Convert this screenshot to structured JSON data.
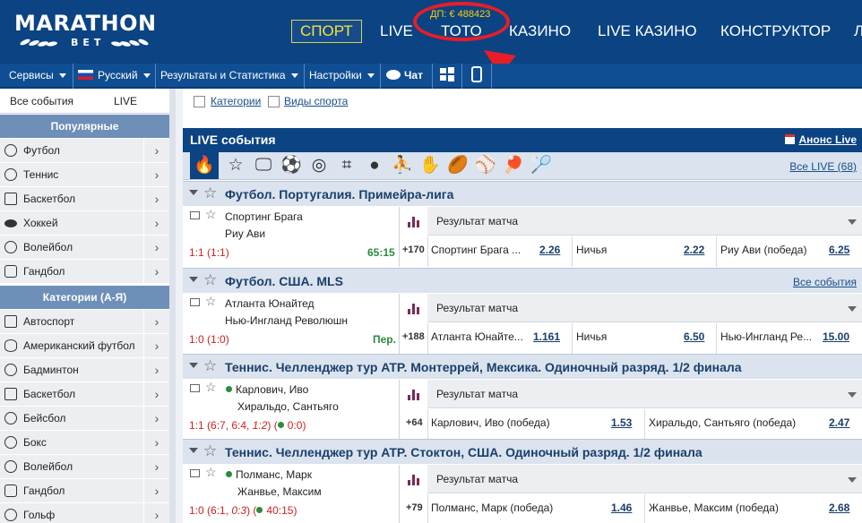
{
  "header": {
    "logo_top": "MARATHON",
    "logo_bottom": "BET",
    "nav": [
      "СПОРТ",
      "LIVE",
      "ТОТО",
      "КАЗИНО",
      "LIVE КАЗИНО",
      "КОНСТРУКТОР",
      "Л"
    ],
    "toto_balance": "ДП: € 488423",
    "accent": "#e81d28"
  },
  "toolbar": {
    "services": "Сервисы",
    "language": "Русский",
    "results": "Результаты и Статистика",
    "settings": "Настройки",
    "chat": "Чат"
  },
  "sidebar": {
    "tabs": [
      "Все события",
      "LIVE"
    ],
    "popular_title": "Популярные",
    "popular": [
      "Футбол",
      "Теннис",
      "Баскетбол",
      "Хоккей",
      "Волейбол",
      "Гандбол"
    ],
    "categories_title": "Категории (А-Я)",
    "categories": [
      "Автоспорт",
      "Американский футбол",
      "Бадминтон",
      "Баскетбол",
      "Бейсбол",
      "Бокс",
      "Волейбол",
      "Гандбол",
      "Гольф"
    ]
  },
  "filters": {
    "categories": "Категории",
    "sports": "Виды спорта"
  },
  "live": {
    "title": "LIVE события",
    "announce": "Анонс Live",
    "all_live": "Все LIVE (68)"
  },
  "events": [
    {
      "league": "Футбол. Португалия. Примейра-лига",
      "league_link": "",
      "team1": "Спортинг Брага",
      "team2": "Риу Ави",
      "live_dot": false,
      "score_main": "1:1",
      "score_detail": "(1:1)",
      "score_serving": "",
      "time": "65:15",
      "market": "Результат матча",
      "more": "+170",
      "outcomes": [
        {
          "name": "Спортинг Брага ...",
          "odds": "2.26"
        },
        {
          "name": "Ничья",
          "odds": "2.22"
        },
        {
          "name": "Риу Ави (победа)",
          "odds": "6.25"
        }
      ]
    },
    {
      "league": "Футбол. США. MLS",
      "league_link": "Все события",
      "team1": "Атланта Юнайтед",
      "team2": "Нью-Ингланд Революшн",
      "live_dot": false,
      "score_main": "1:0",
      "score_detail": "(1:0)",
      "score_serving": "",
      "time": "Пер.",
      "market": "Результат матча",
      "more": "+188",
      "outcomes": [
        {
          "name": "Атланта Юнайте...",
          "odds": "1.161"
        },
        {
          "name": "Ничья",
          "odds": "6.50"
        },
        {
          "name": "Нью-Ингланд Ре...",
          "odds": "15.00"
        }
      ]
    },
    {
      "league": "Теннис. Челленджер тур ATP. Монтеррей, Мексика. Одиночный разряд. 1/2 финала",
      "league_link": "",
      "team1": "Карлович, Иво",
      "team2": "Хиральдо, Сантьяго",
      "live_dot": true,
      "score_main": "1:1",
      "score_detail": "(6:7, 6:4, ",
      "score_italic": "1:2",
      "score_serving": "0:0",
      "time": "",
      "market": "Результат матча",
      "more": "+64",
      "outcomes": [
        {
          "name": "Карлович, Иво (победа)",
          "odds": "1.53"
        },
        {
          "name": "Хиральдо, Сантьяго (победа)",
          "odds": "2.47"
        }
      ]
    },
    {
      "league": "Теннис. Челленджер тур ATP. Стоктон, США. Одиночный разряд. 1/2 финала",
      "league_link": "",
      "team1": "Полманс, Марк",
      "team2": "Жанвье, Максим",
      "live_dot": true,
      "score_main": "1:0",
      "score_detail": "(6:1, ",
      "score_italic": "0:3",
      "score_serving": "40:15",
      "time": "",
      "market": "Результат матча",
      "more": "+79",
      "outcomes": [
        {
          "name": "Полманс, Марк (победа)",
          "odds": "1.46"
        },
        {
          "name": "Жанвье, Максим (победа)",
          "odds": "2.68"
        }
      ]
    }
  ]
}
